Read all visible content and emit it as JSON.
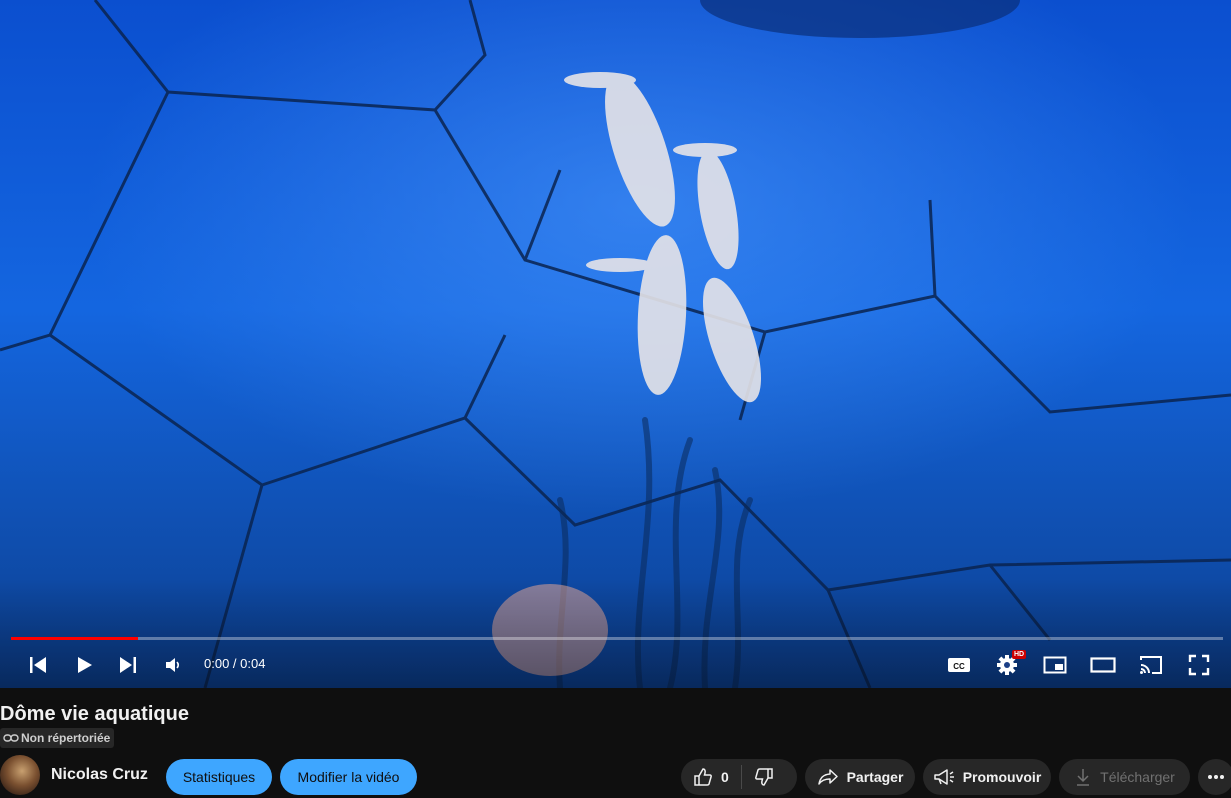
{
  "player": {
    "time_display": "0:00 / 0:04",
    "progress_fraction": 0.105,
    "hd_badge": "HD"
  },
  "video": {
    "title": "Dôme vie aquatique",
    "privacy_label": "Non répertoriée"
  },
  "channel": {
    "name": "Nicolas Cruz"
  },
  "actions": {
    "stats_label": "Statistiques",
    "edit_label": "Modifier la vidéo",
    "like_count": "0",
    "share_label": "Partager",
    "promote_label": "Promouvoir",
    "download_label": "Télécharger"
  },
  "colors": {
    "accent_blue": "#3ea6ff",
    "progress_red": "#ff0000",
    "button_bg": "#272727"
  }
}
